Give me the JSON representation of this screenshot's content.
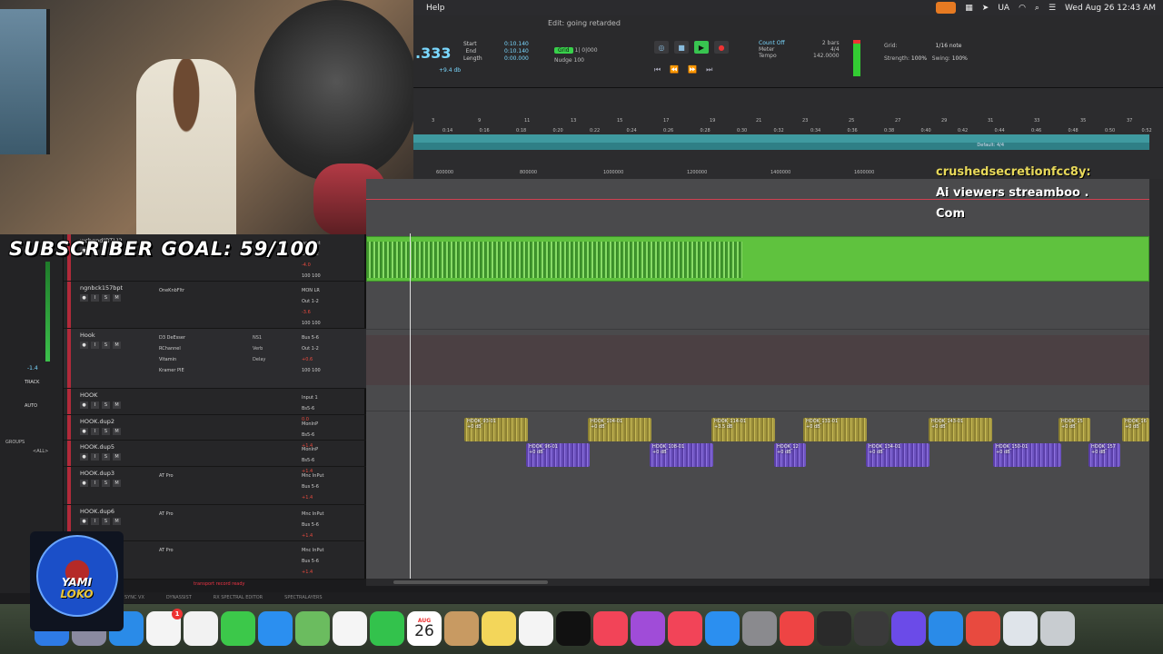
{
  "menubar": {
    "help": "Help",
    "ua": "UA",
    "datetime": "Wed Aug 26  12:43 AM"
  },
  "window": {
    "title": "Edit: going retarded"
  },
  "transport": {
    "counter": ".333",
    "counter_small": "+9.4 db",
    "labels": [
      "Start",
      "End",
      "Length"
    ],
    "values": [
      "0:10.140",
      "0:10.140",
      "0:00.000"
    ],
    "grid_label": "Grid",
    "grid_value": "1| 0|000",
    "nudge_label": "Nudge",
    "nudge_value": "100",
    "count_off": "Count Off",
    "meter_label": "Meter",
    "tempo_label": "Tempo",
    "bars": "2 bars",
    "meter_value": "4/4",
    "tempo_value": "142.0000",
    "grid_set_label": "Grid:",
    "grid_set_value": "1/16 note",
    "strength_label": "Strength:",
    "strength_value": "100%",
    "swing_label": "Swing:",
    "swing_value": "100%"
  },
  "ruler": {
    "bars": [
      "3",
      "9",
      "11",
      "13",
      "15",
      "17",
      "19",
      "21",
      "23",
      "25",
      "27",
      "29",
      "31",
      "33",
      "35",
      "37",
      "39",
      "41",
      "43"
    ],
    "minsecs": [
      "0:14",
      "0:16",
      "0:18",
      "0:20",
      "0:22",
      "0:24",
      "0:26",
      "0:28",
      "0:30",
      "0:32",
      "0:34",
      "0:36",
      "0:38",
      "0:40",
      "0:42",
      "0:44",
      "0:46",
      "0:48",
      "0:50",
      "0:52"
    ],
    "samples": [
      "600000",
      "800000",
      "1000000",
      "1200000",
      "1400000",
      "1600000"
    ],
    "meter_marker": "Default: 4/4"
  },
  "overlay": {
    "line1": "crushedsecretionfcc8y:",
    "line2": "Ai viewers streamboo .",
    "line3": "Com"
  },
  "subscriber_goal": "SUBSCRIBER GOAL: 59/100",
  "left_panel": {
    "vol": "-1.4",
    "track_label": "TRACK",
    "auto_label": "AUTO",
    "groups_label": "GROUPS",
    "all_label": "<ALL>"
  },
  "tracks": [
    {
      "name": "wchgnd(BTL)2",
      "insert": [
        "",
        ""
      ],
      "io": [
        "no input",
        "Out 1-2"
      ],
      "vol": "-4.0",
      "pan": "100 100"
    },
    {
      "name": "ngnbck157bpt",
      "insert": [
        "OneKnbFltr"
      ],
      "io": [
        "MON LR",
        "Out 1-2"
      ],
      "vol": "-3.6",
      "pan": "100 100"
    },
    {
      "name": "Hook",
      "insert": [
        "D3 DeEsser",
        "RChannel",
        "Vitamin",
        "Kramer PIE"
      ],
      "sends": [
        "NS1",
        "Verb",
        "Delay"
      ],
      "io": [
        "Bus 5-6",
        "Out 1-2"
      ],
      "vol": "+0.6",
      "pan": "100 100"
    },
    {
      "name": "HOOK",
      "insert": [],
      "io": [
        "Input 1",
        "Bs5-6"
      ],
      "vol": "0.0",
      "pan": ""
    },
    {
      "name": "HOOK.dup2",
      "insert": [],
      "io": [
        "MonInP",
        "Bs5-6"
      ],
      "vol": "+1.4",
      "pan": ""
    },
    {
      "name": "HOOK.dup5",
      "insert": [],
      "io": [
        "MonInP",
        "Bs5-6"
      ],
      "vol": "+1.4",
      "pan": ""
    },
    {
      "name": "HOOK.dup3",
      "insert": [
        "AT Pro"
      ],
      "io": [
        "Mnc InPut",
        "Bus 5-6"
      ],
      "vol": "+1.4",
      "pan": ""
    },
    {
      "name": "HOOK.dup6",
      "insert": [
        "AT Pro"
      ],
      "io": [
        "Mnc InPut",
        "Bus 5-6"
      ],
      "vol": "+1.4",
      "pan": ""
    },
    {
      "name": "",
      "insert": [
        "AT Pro"
      ],
      "io": [
        "Mnc InPut",
        "Bus 5-6"
      ],
      "vol": "+1.4",
      "pan": ""
    }
  ],
  "clips": {
    "row1": [
      {
        "name": "HOOK_93-01",
        "db": "+0 dB"
      },
      {
        "name": "HOOK_104-01",
        "db": "+0 dB"
      },
      {
        "name": "HOOK_114-01",
        "db": "+3.5 dB"
      },
      {
        "name": "HOOK_131-01",
        "db": "+0 dB"
      },
      {
        "name": "HOOK_143-01",
        "db": "+0 dB"
      },
      {
        "name": "HOOK_15",
        "db": "+0 dB"
      },
      {
        "name": "HOOK_16",
        "db": "+0 dB"
      }
    ],
    "row2": [
      {
        "name": "HOOK_96-01",
        "db": "+0 dB"
      },
      {
        "name": "HOOK_108-01",
        "db": "+0 dB"
      },
      {
        "name": "HOOK_12",
        "db": "+0 dB"
      },
      {
        "name": "HOOK_134-01",
        "db": "+0 dB"
      },
      {
        "name": "HOOK_150-01",
        "db": "+0 dB"
      },
      {
        "name": "HOOK_157",
        "db": "+0 dB"
      }
    ]
  },
  "plugin_bar": [
    "SYNC VX",
    "DYNASSIST",
    "RX SPECTRAL EDITOR",
    "SPECTRALAYERS"
  ],
  "transport_record_text": "transport record ready",
  "dock": {
    "calendar_month": "AUG",
    "calendar_day": "26",
    "badge": "1"
  },
  "logo": {
    "line1": "YAMI",
    "line2": "LOKO"
  }
}
